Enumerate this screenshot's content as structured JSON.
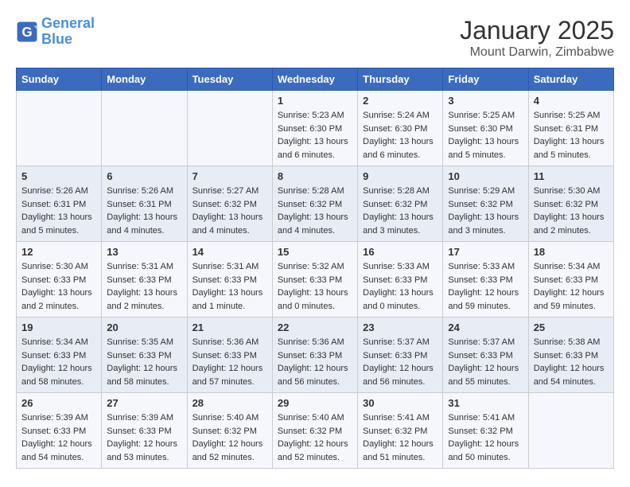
{
  "header": {
    "logo_line1": "General",
    "logo_line2": "Blue",
    "title": "January 2025",
    "subtitle": "Mount Darwin, Zimbabwe"
  },
  "calendar": {
    "days_of_week": [
      "Sunday",
      "Monday",
      "Tuesday",
      "Wednesday",
      "Thursday",
      "Friday",
      "Saturday"
    ],
    "weeks": [
      [
        {
          "day": "",
          "info": ""
        },
        {
          "day": "",
          "info": ""
        },
        {
          "day": "",
          "info": ""
        },
        {
          "day": "1",
          "info": "Sunrise: 5:23 AM\nSunset: 6:30 PM\nDaylight: 13 hours\nand 6 minutes."
        },
        {
          "day": "2",
          "info": "Sunrise: 5:24 AM\nSunset: 6:30 PM\nDaylight: 13 hours\nand 6 minutes."
        },
        {
          "day": "3",
          "info": "Sunrise: 5:25 AM\nSunset: 6:30 PM\nDaylight: 13 hours\nand 5 minutes."
        },
        {
          "day": "4",
          "info": "Sunrise: 5:25 AM\nSunset: 6:31 PM\nDaylight: 13 hours\nand 5 minutes."
        }
      ],
      [
        {
          "day": "5",
          "info": "Sunrise: 5:26 AM\nSunset: 6:31 PM\nDaylight: 13 hours\nand 5 minutes."
        },
        {
          "day": "6",
          "info": "Sunrise: 5:26 AM\nSunset: 6:31 PM\nDaylight: 13 hours\nand 4 minutes."
        },
        {
          "day": "7",
          "info": "Sunrise: 5:27 AM\nSunset: 6:32 PM\nDaylight: 13 hours\nand 4 minutes."
        },
        {
          "day": "8",
          "info": "Sunrise: 5:28 AM\nSunset: 6:32 PM\nDaylight: 13 hours\nand 4 minutes."
        },
        {
          "day": "9",
          "info": "Sunrise: 5:28 AM\nSunset: 6:32 PM\nDaylight: 13 hours\nand 3 minutes."
        },
        {
          "day": "10",
          "info": "Sunrise: 5:29 AM\nSunset: 6:32 PM\nDaylight: 13 hours\nand 3 minutes."
        },
        {
          "day": "11",
          "info": "Sunrise: 5:30 AM\nSunset: 6:32 PM\nDaylight: 13 hours\nand 2 minutes."
        }
      ],
      [
        {
          "day": "12",
          "info": "Sunrise: 5:30 AM\nSunset: 6:33 PM\nDaylight: 13 hours\nand 2 minutes."
        },
        {
          "day": "13",
          "info": "Sunrise: 5:31 AM\nSunset: 6:33 PM\nDaylight: 13 hours\nand 2 minutes."
        },
        {
          "day": "14",
          "info": "Sunrise: 5:31 AM\nSunset: 6:33 PM\nDaylight: 13 hours\nand 1 minute."
        },
        {
          "day": "15",
          "info": "Sunrise: 5:32 AM\nSunset: 6:33 PM\nDaylight: 13 hours\nand 0 minutes."
        },
        {
          "day": "16",
          "info": "Sunrise: 5:33 AM\nSunset: 6:33 PM\nDaylight: 13 hours\nand 0 minutes."
        },
        {
          "day": "17",
          "info": "Sunrise: 5:33 AM\nSunset: 6:33 PM\nDaylight: 12 hours\nand 59 minutes."
        },
        {
          "day": "18",
          "info": "Sunrise: 5:34 AM\nSunset: 6:33 PM\nDaylight: 12 hours\nand 59 minutes."
        }
      ],
      [
        {
          "day": "19",
          "info": "Sunrise: 5:34 AM\nSunset: 6:33 PM\nDaylight: 12 hours\nand 58 minutes."
        },
        {
          "day": "20",
          "info": "Sunrise: 5:35 AM\nSunset: 6:33 PM\nDaylight: 12 hours\nand 58 minutes."
        },
        {
          "day": "21",
          "info": "Sunrise: 5:36 AM\nSunset: 6:33 PM\nDaylight: 12 hours\nand 57 minutes."
        },
        {
          "day": "22",
          "info": "Sunrise: 5:36 AM\nSunset: 6:33 PM\nDaylight: 12 hours\nand 56 minutes."
        },
        {
          "day": "23",
          "info": "Sunrise: 5:37 AM\nSunset: 6:33 PM\nDaylight: 12 hours\nand 56 minutes."
        },
        {
          "day": "24",
          "info": "Sunrise: 5:37 AM\nSunset: 6:33 PM\nDaylight: 12 hours\nand 55 minutes."
        },
        {
          "day": "25",
          "info": "Sunrise: 5:38 AM\nSunset: 6:33 PM\nDaylight: 12 hours\nand 54 minutes."
        }
      ],
      [
        {
          "day": "26",
          "info": "Sunrise: 5:39 AM\nSunset: 6:33 PM\nDaylight: 12 hours\nand 54 minutes."
        },
        {
          "day": "27",
          "info": "Sunrise: 5:39 AM\nSunset: 6:33 PM\nDaylight: 12 hours\nand 53 minutes."
        },
        {
          "day": "28",
          "info": "Sunrise: 5:40 AM\nSunset: 6:32 PM\nDaylight: 12 hours\nand 52 minutes."
        },
        {
          "day": "29",
          "info": "Sunrise: 5:40 AM\nSunset: 6:32 PM\nDaylight: 12 hours\nand 52 minutes."
        },
        {
          "day": "30",
          "info": "Sunrise: 5:41 AM\nSunset: 6:32 PM\nDaylight: 12 hours\nand 51 minutes."
        },
        {
          "day": "31",
          "info": "Sunrise: 5:41 AM\nSunset: 6:32 PM\nDaylight: 12 hours\nand 50 minutes."
        },
        {
          "day": "",
          "info": ""
        }
      ]
    ]
  }
}
